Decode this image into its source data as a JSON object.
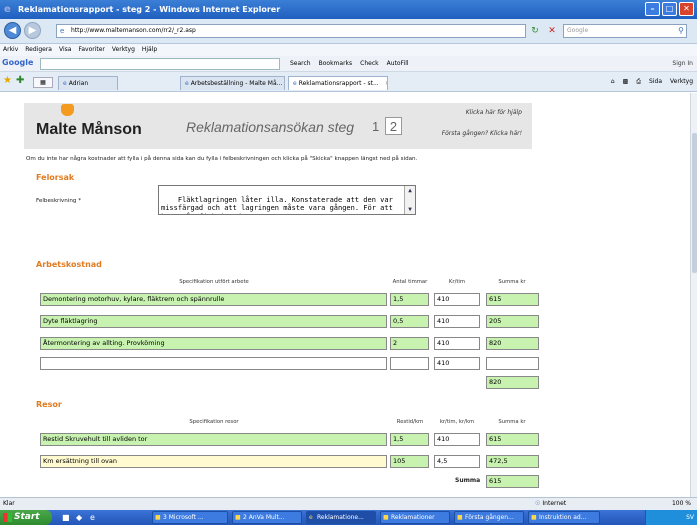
{
  "window": {
    "title": "Reklamationsrapport - steg 2 - Windows Internet Explorer",
    "minimize": "–",
    "maximize": "□",
    "close": "✕"
  },
  "address": {
    "url": "http://www.maltemanson.com/rr2/_r2.asp",
    "search_placeholder": "Google"
  },
  "menu": [
    "Arkiv",
    "Redigera",
    "Visa",
    "Favoriter",
    "Verktyg",
    "Hjälp"
  ],
  "google_toolbar": {
    "logo": "Google",
    "items": [
      "Search",
      "Bookmarks",
      "Check",
      "AutoFill"
    ],
    "signin": "Sign In"
  },
  "tabs": [
    {
      "label": "Adrian"
    },
    {
      "label": "Arbetsbeställning - Malte Må..."
    },
    {
      "label": "Reklamationsrapport - st..."
    }
  ],
  "command_bar": [
    "Sida",
    "Verktyg"
  ],
  "header": {
    "logo": "Malte Månson",
    "title": "Reklamationsansökan steg",
    "step1": "1",
    "step2": "2",
    "help_link": "Klicka här för hjälp",
    "first_time_link": "Första gången? Klicka här!"
  },
  "intro": "Om du inte har några kostnader att fylla i på denna sida kan du fylla i felbeskrivningen och klicka på \"Skicka\" knappen längst ned på sidan.",
  "felorsak": {
    "title": "Felorsak",
    "label": "Felbeskrivning *",
    "text": "Fläktlagringen låter illa. Konstaterade att den var missfärgad och att lagringen måste vara gången. För att komma åt fick jag demontera"
  },
  "arbetskostnad": {
    "title": "Arbetskostnad",
    "headers": [
      "Specifikation utfört arbete",
      "Antal timmar",
      "Kr/tim",
      "Summa kr"
    ],
    "rows": [
      {
        "spec": "Demontering motorhuv, kylare, fläktrem och spännrulle",
        "timmar": "1,5",
        "kr": "410",
        "summa": "615"
      },
      {
        "spec": "Dyte fläktlagring",
        "timmar": "0,5",
        "kr": "410",
        "summa": "205"
      },
      {
        "spec": "Återmontering av allting. Provköming",
        "timmar": "2",
        "kr": "410",
        "summa": "820"
      },
      {
        "spec": "",
        "timmar": "",
        "kr": "410",
        "summa": ""
      }
    ],
    "total": "820"
  },
  "resor": {
    "title": "Resor",
    "headers": [
      "Specifikation resor",
      "Restid/km",
      "kr/tim, kr/km",
      "Summa kr"
    ],
    "rows": [
      {
        "spec": "Restid Skruvehult till avliden tor",
        "tid": "1,5",
        "kr": "410",
        "summa": "615"
      },
      {
        "spec": "Km ersättning till ovan",
        "tid": "105",
        "kr": "4,5",
        "summa": "472,5"
      }
    ],
    "summa_label": "Summa",
    "summa": "615"
  },
  "status": {
    "left": "Klar",
    "zone": "Internet",
    "zoom": "100 %"
  },
  "taskbar": {
    "start": "Start",
    "tasks": [
      "3 Microsoft ...",
      "2 AnVa Mult...",
      "Reklamatione...",
      "Reklamationer",
      "Första gången...",
      "Instruktion ad..."
    ],
    "tray": "SV"
  },
  "colors": {
    "accent": "#e07b20",
    "field_green": "#c7f2b0",
    "field_yellow": "#fffad0",
    "logo_orange": "#f39a1f"
  }
}
